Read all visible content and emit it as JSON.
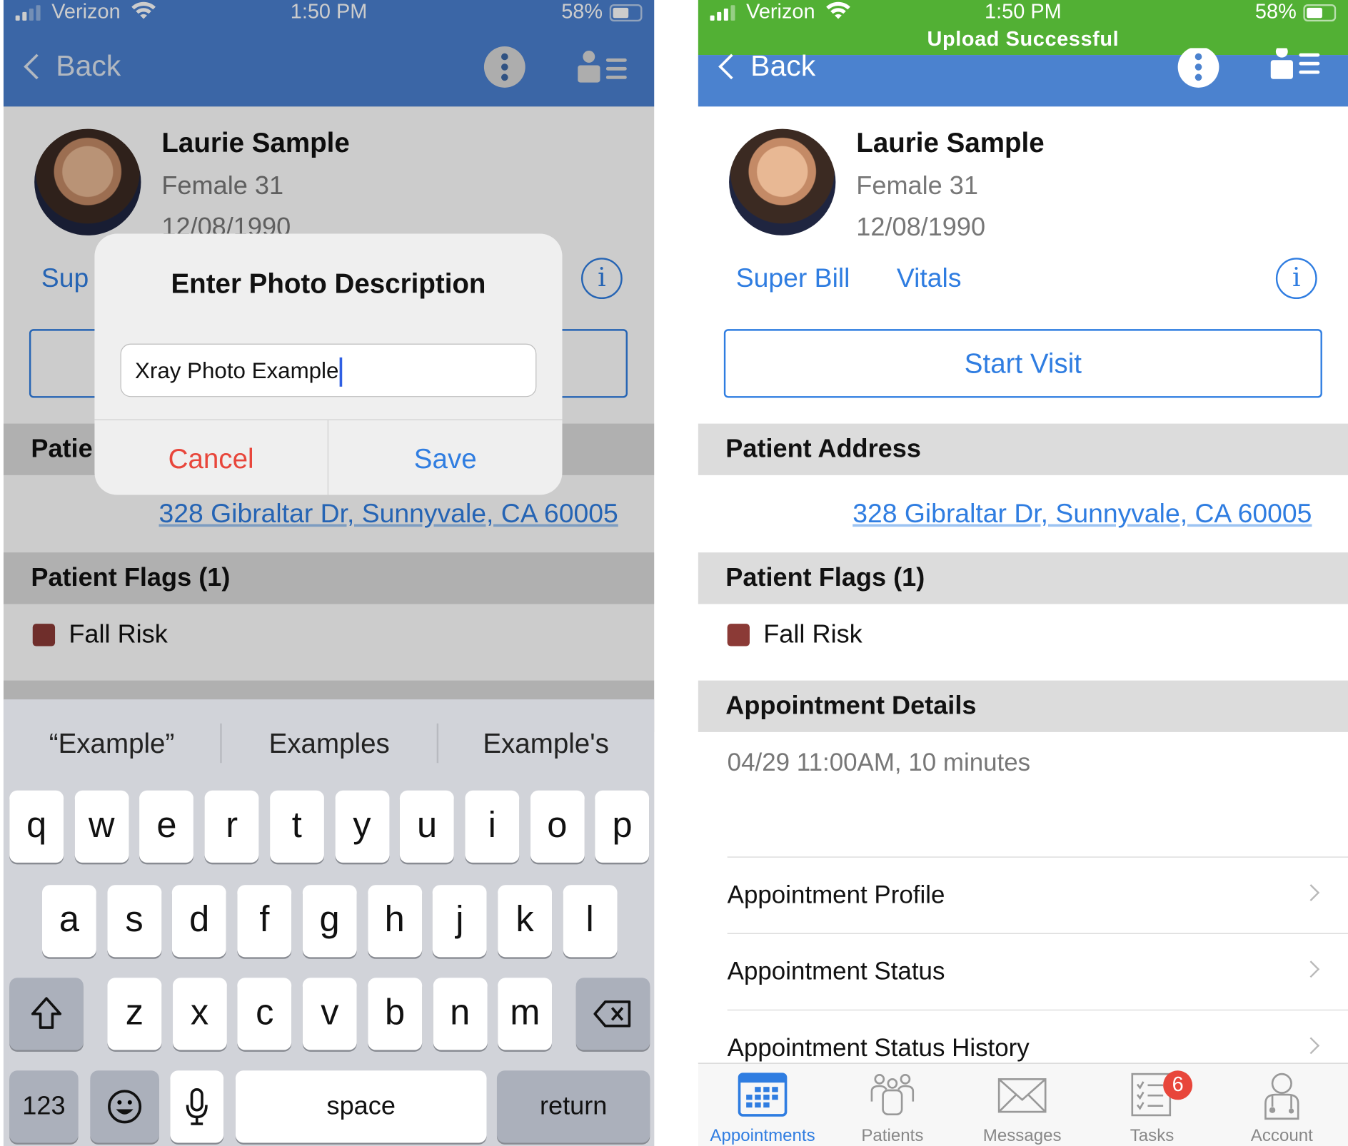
{
  "left_screen": {
    "status_bar": {
      "carrier": "Verizon",
      "time": "1:50 PM",
      "battery": "58%"
    },
    "nav": {
      "back_label": "Back",
      "more_icon": "kebab-icon",
      "patient_list_icon": "person-list-icon"
    },
    "patient": {
      "name": "Laurie Sample",
      "sex_age": "Female 31",
      "dob": "12/08/1990"
    },
    "links": {
      "super_bill_partial": "Sup"
    },
    "section_partial": "Patie",
    "address": "328 Gibraltar Dr, Sunnyvale, CA 60005",
    "flags_header": "Patient Flags (1)",
    "flag": {
      "label": "Fall Risk",
      "color": "#8b3a36"
    },
    "dialog": {
      "title": "Enter Photo Description",
      "input_value": "Xray Photo Example",
      "cancel_label": "Cancel",
      "save_label": "Save"
    },
    "keyboard": {
      "suggestions": [
        "“Example”",
        "Examples",
        "Example's"
      ],
      "row1": [
        "q",
        "w",
        "e",
        "r",
        "t",
        "y",
        "u",
        "i",
        "o",
        "p"
      ],
      "row2": [
        "a",
        "s",
        "d",
        "f",
        "g",
        "h",
        "j",
        "k",
        "l"
      ],
      "row3": [
        "z",
        "x",
        "c",
        "v",
        "b",
        "n",
        "m"
      ],
      "numbers_label": "123",
      "space_label": "space",
      "return_label": "return"
    }
  },
  "right_screen": {
    "status_bar": {
      "carrier": "Verizon",
      "time": "1:50 PM",
      "battery": "58%",
      "banner": "Upload Successful"
    },
    "nav": {
      "back_label": "Back"
    },
    "patient": {
      "name": "Laurie Sample",
      "sex_age": "Female 31",
      "dob": "12/08/1990"
    },
    "links": {
      "super_bill": "Super Bill",
      "vitals": "Vitals"
    },
    "start_visit_label": "Start Visit",
    "address_header": "Patient Address",
    "address": "328 Gibraltar Dr, Sunnyvale, CA 60005",
    "flags_header": "Patient Flags (1)",
    "flag": {
      "label": "Fall Risk",
      "color": "#8b3a36"
    },
    "appointment_header": "Appointment Details",
    "appointment_time": "04/29 11:00AM, 10 minutes",
    "rows": [
      "Appointment Profile",
      "Appointment Status",
      "Appointment Status History"
    ],
    "tabs": [
      {
        "label": "Appointments",
        "icon": "calendar-icon",
        "active": true
      },
      {
        "label": "Patients",
        "icon": "patients-icon"
      },
      {
        "label": "Messages",
        "icon": "envelope-icon"
      },
      {
        "label": "Tasks",
        "icon": "checklist-icon",
        "badge": "6"
      },
      {
        "label": "Account",
        "icon": "doctor-icon"
      }
    ]
  },
  "colors": {
    "nav_blue_dimmed": "#3d67a3",
    "nav_blue": "#4b82cf",
    "success_green": "#52b034",
    "link_blue": "#2f7de1",
    "cancel_red": "#e8463b",
    "active_tab": "#2f7de1"
  }
}
